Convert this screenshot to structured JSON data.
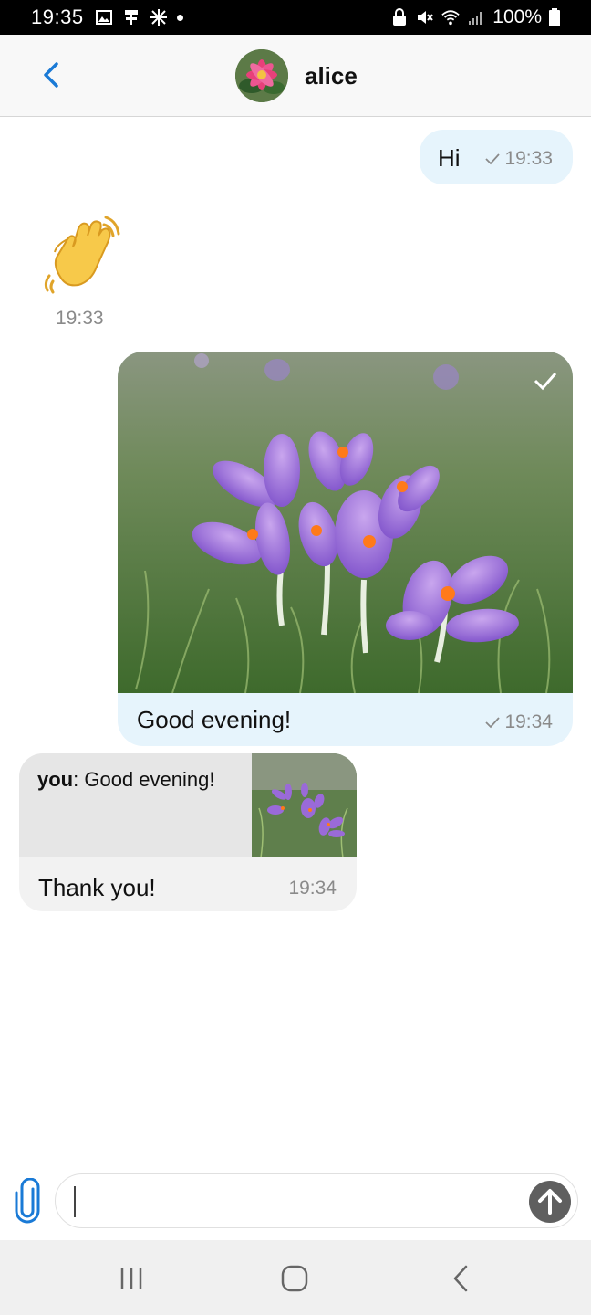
{
  "status_bar": {
    "time": "19:35",
    "battery": "100%",
    "icons": [
      "image-icon",
      "usb-icon",
      "sync-icon",
      "dot-icon",
      "lock-icon",
      "mute-icon",
      "wifi-icon",
      "signal-icon",
      "battery-icon"
    ]
  },
  "header": {
    "contact_name": "alice",
    "back_icon": "chevron-left-icon",
    "accent_color": "#1a73e8"
  },
  "messages": [
    {
      "direction": "outgoing",
      "type": "text",
      "text": "Hi",
      "time": "19:33",
      "status": "sent"
    },
    {
      "direction": "incoming",
      "type": "emoji",
      "emoji": "waving-hand",
      "time": "19:33"
    },
    {
      "direction": "outgoing",
      "type": "image",
      "caption": "Good evening!",
      "time": "19:34",
      "status": "sent",
      "image": "purple-crocus-flowers"
    },
    {
      "direction": "incoming",
      "type": "reply",
      "quote_author": "you",
      "quote_text": ": Good evening!",
      "text": "Thank you!",
      "time": "19:34"
    }
  ],
  "composer": {
    "value": "",
    "placeholder": "",
    "attach_icon": "paperclip-icon",
    "send_icon": "arrow-up-icon"
  },
  "nav_bar": {
    "icons": [
      "recent-apps-icon",
      "home-icon",
      "back-icon"
    ]
  },
  "colors": {
    "outgoing_bubble": "#e6f4fc",
    "incoming_bubble": "#efefef",
    "header_bg": "#f8f8f8"
  }
}
